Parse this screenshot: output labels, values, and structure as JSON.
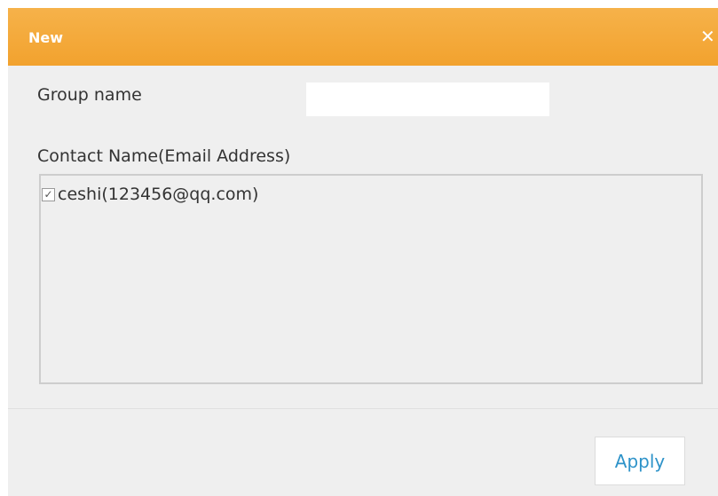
{
  "dialog": {
    "title": "New",
    "close_icon": "close-icon",
    "close_glyph": "✕"
  },
  "form": {
    "group_name_label": "Group name",
    "group_name_value": "",
    "group_name_placeholder": "",
    "contacts_label": "Contact Name(Email Address)",
    "contacts": [
      {
        "label": "ceshi(123456@qq.com)",
        "checked": true
      }
    ]
  },
  "footer": {
    "apply_label": "Apply"
  },
  "colors": {
    "titlebar": "#f2a22e",
    "dialog_bg": "#efefef",
    "apply_text": "#2e93c9"
  }
}
